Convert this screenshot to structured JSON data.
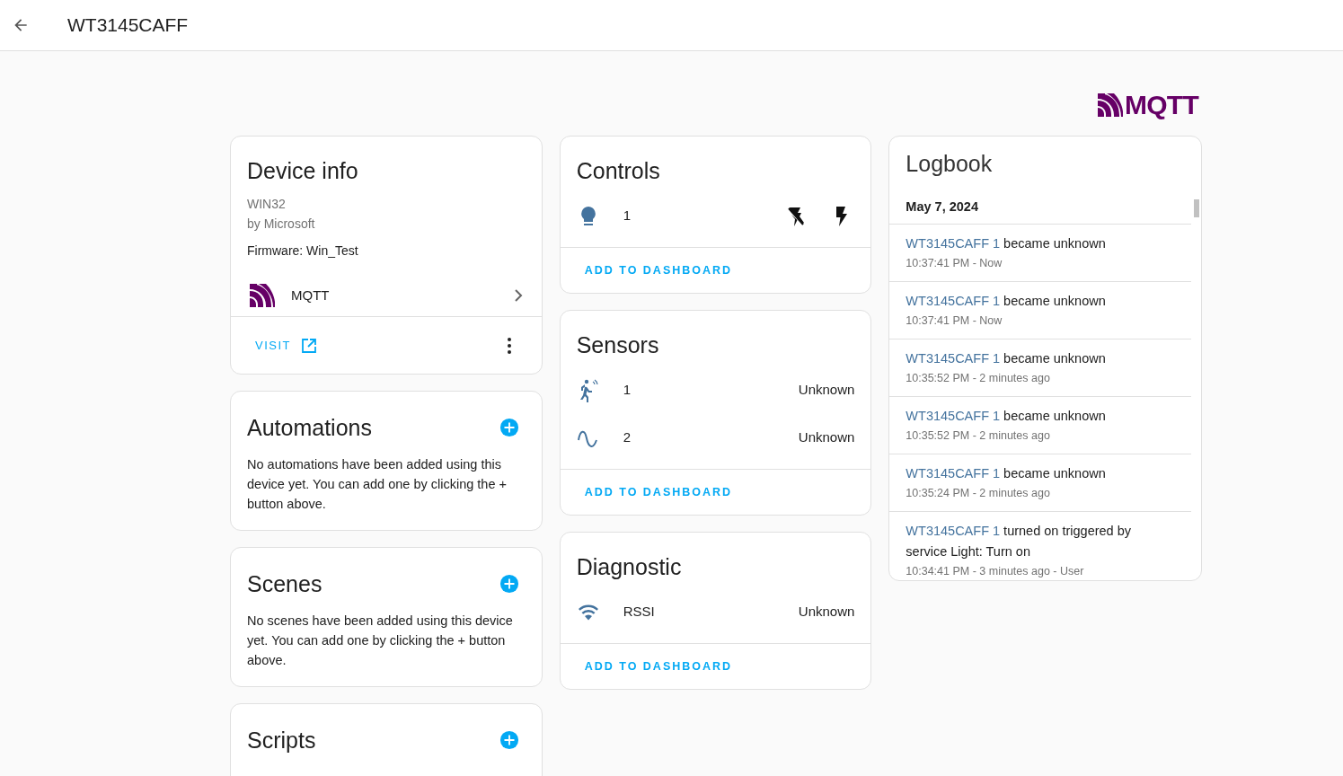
{
  "header": {
    "title": "WT3145CAFF"
  },
  "brand_logo": {
    "text": "MQTT"
  },
  "device_info": {
    "title": "Device info",
    "model": "WIN32",
    "manufacturer": "by Microsoft",
    "firmware": "Firmware: Win_Test",
    "integration": "MQTT",
    "visit_label": "VISIT"
  },
  "automations": {
    "title": "Automations",
    "text": "No automations have been added using this device yet. You can add one by clicking the + button above."
  },
  "scenes": {
    "title": "Scenes",
    "text": "No scenes have been added using this device yet. You can add one by clicking the + button above."
  },
  "scripts": {
    "title": "Scripts"
  },
  "entity_cards": [
    {
      "title": "Controls",
      "entities": [
        {
          "kind": "light",
          "name": "1",
          "actions": [
            {
              "kind": "flash-off"
            },
            {
              "kind": "flash"
            }
          ]
        }
      ],
      "footer": "ADD TO DASHBOARD"
    },
    {
      "title": "Sensors",
      "entities": [
        {
          "kind": "motion",
          "name": "1",
          "state": "Unknown"
        },
        {
          "kind": "wave",
          "name": "2",
          "state": "Unknown"
        }
      ],
      "footer": "ADD TO DASHBOARD"
    },
    {
      "title": "Diagnostic",
      "entities": [
        {
          "kind": "signal",
          "name": "RSSI",
          "state": "Unknown"
        }
      ],
      "footer": "ADD TO DASHBOARD"
    }
  ],
  "logbook": {
    "title": "Logbook",
    "date": "May 7, 2024",
    "entries": [
      {
        "entity": "WT3145CAFF 1",
        "message": "became unknown",
        "time": "10:37:41 PM - Now"
      },
      {
        "entity": "WT3145CAFF 1",
        "message": "became unknown",
        "time": "10:37:41 PM - Now"
      },
      {
        "entity": "WT3145CAFF 1",
        "message": "became unknown",
        "time": "10:35:52 PM - 2 minutes ago"
      },
      {
        "entity": "WT3145CAFF 1",
        "message": "became unknown",
        "time": "10:35:52 PM - 2 minutes ago"
      },
      {
        "entity": "WT3145CAFF 1",
        "message": "became unknown",
        "time": "10:35:24 PM - 2 minutes ago"
      },
      {
        "entity": "WT3145CAFF 1",
        "message": "turned on triggered by service Light: Turn on",
        "time": "10:34:41 PM - 3 minutes ago - User"
      }
    ]
  }
}
